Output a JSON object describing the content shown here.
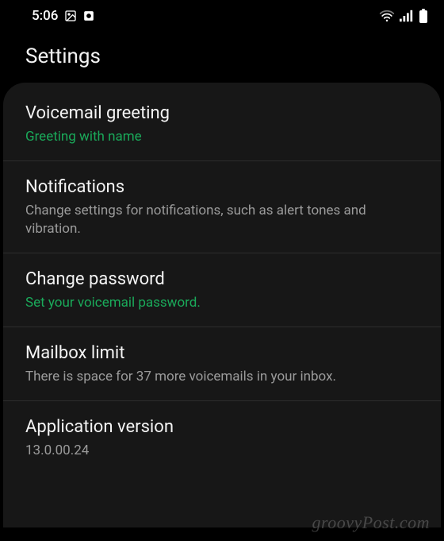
{
  "status": {
    "time": "5:06"
  },
  "page": {
    "title": "Settings"
  },
  "items": [
    {
      "title": "Voicemail greeting",
      "sub": "Greeting with name",
      "subStyle": "green"
    },
    {
      "title": "Notifications",
      "sub": "Change settings for notifications, such as alert tones and vibration.",
      "subStyle": "grey"
    },
    {
      "title": "Change password",
      "sub": "Set your voicemail password.",
      "subStyle": "green"
    },
    {
      "title": "Mailbox limit",
      "sub": "There is space for 37 more voicemails in your inbox.",
      "subStyle": "grey"
    },
    {
      "title": "Application version",
      "sub": "13.0.00.24",
      "subStyle": "grey"
    }
  ],
  "watermark": "groovyPost.com"
}
